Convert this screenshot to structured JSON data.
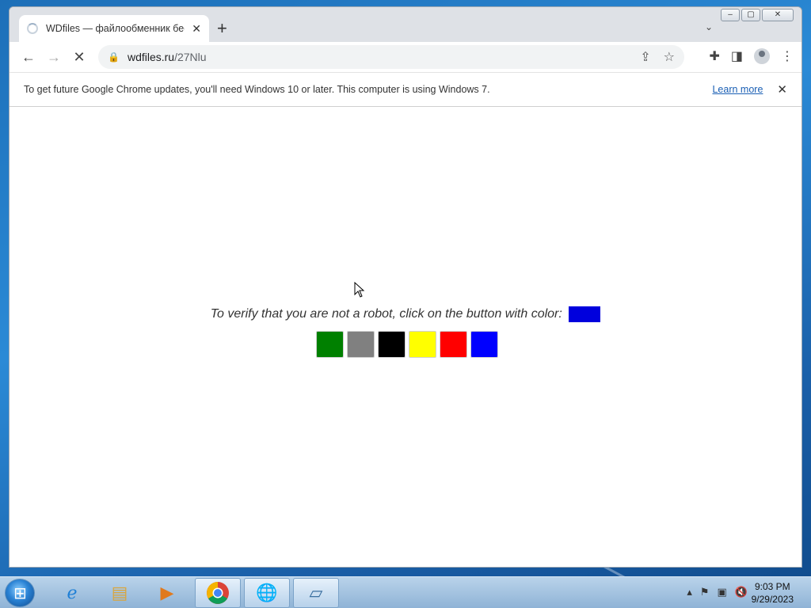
{
  "browser": {
    "tab": {
      "title": "WDfiles — файлообменник бес",
      "close": "✕"
    },
    "new_tab": "+",
    "tab_menu": "⌄",
    "toolbar": {
      "back": "←",
      "forward": "→",
      "stop": "✕"
    },
    "url": {
      "host": "wdfiles.ru",
      "path": "/27Nlu"
    },
    "omnibox_icons": [
      "share-icon",
      "star-icon"
    ],
    "right_icons": [
      "extensions-icon",
      "side-panel-icon",
      "profile-icon",
      "menu-icon"
    ],
    "caption": {
      "minimize": "‒",
      "restore": "▢",
      "close": "✕"
    }
  },
  "infobar": {
    "message": "To get future Google Chrome updates, you'll need Windows 10 or later. This computer is using Windows 7.",
    "link": "Learn more",
    "close": "✕"
  },
  "captcha": {
    "prompt": "To verify that you are not a robot, click on the button with color:",
    "target_color": "#0000dd",
    "buttons": [
      {
        "name": "green",
        "color": "#008000"
      },
      {
        "name": "gray",
        "color": "#808080"
      },
      {
        "name": "black",
        "color": "#000000"
      },
      {
        "name": "yellow",
        "color": "#ffff00"
      },
      {
        "name": "red",
        "color": "#ff0000"
      },
      {
        "name": "blue",
        "color": "#0000ff"
      }
    ]
  },
  "taskbar": {
    "apps": [
      "internet-explorer-icon",
      "file-explorer-icon",
      "media-player-icon",
      "chrome-icon",
      "download-manager-icon",
      "notepad-icon"
    ],
    "clock": {
      "time": "9:03 PM",
      "date": "9/29/2023"
    }
  }
}
